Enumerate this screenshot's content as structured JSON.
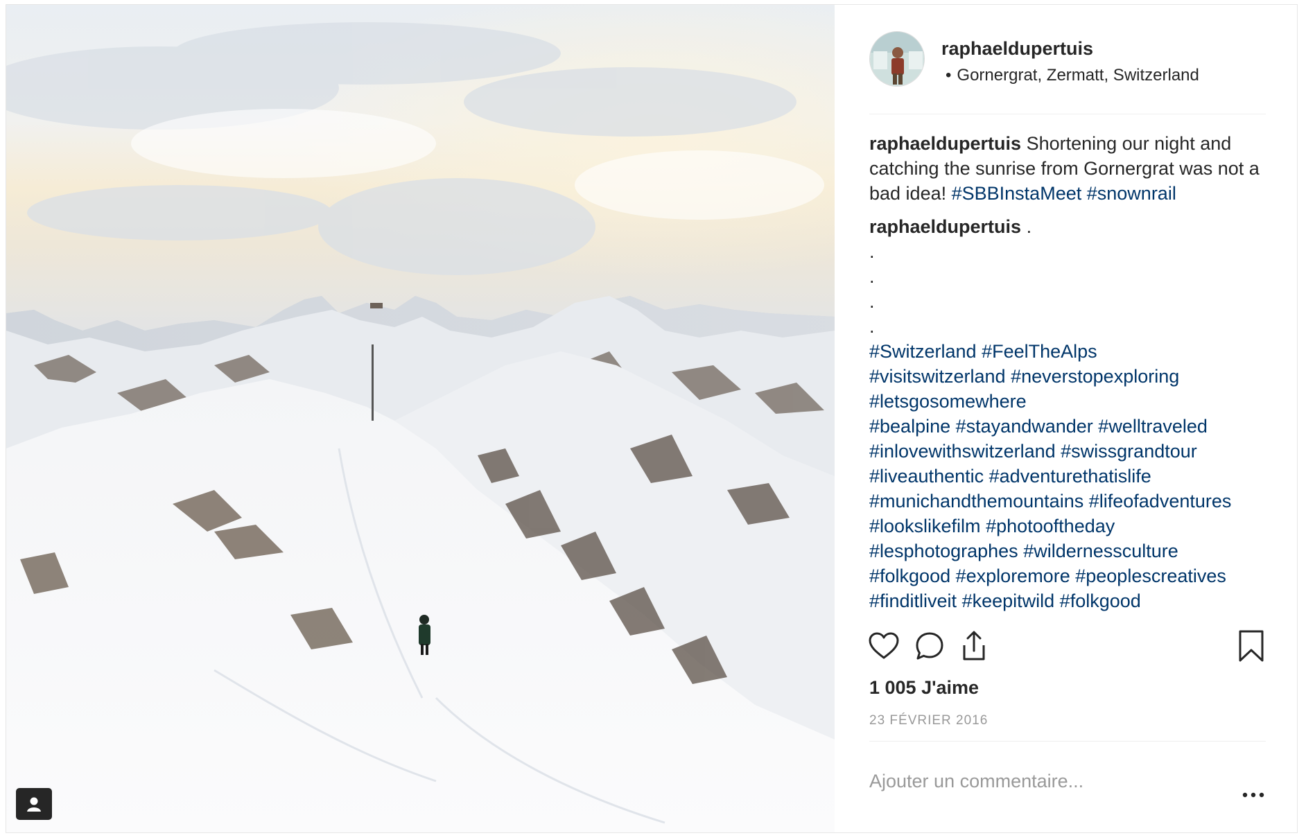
{
  "post": {
    "username": "raphaeldupertuis",
    "location": "Gornergrat, Zermatt, Switzerland",
    "location_dot": "•",
    "caption": {
      "text": "Shortening our night and catching the sunrise from Gornergrat was not a bad idea!",
      "hashtags": [
        "#SBBInstaMeet",
        "#snownrail"
      ]
    },
    "comment": {
      "username": "raphaeldupertuis",
      "first_line": ".",
      "dots": [
        ".",
        ".",
        ".",
        "."
      ],
      "hashtag_lines": [
        [
          "#Switzerland",
          "#FeelTheAlps"
        ],
        [
          "#visitswitzerland",
          "#neverstopexploring"
        ],
        [
          "#letsgosomewhere"
        ],
        [
          "#bealpine",
          "#stayandwander",
          "#welltraveled"
        ],
        [
          "#inlovewithswitzerland",
          "#swissgrandtour"
        ],
        [
          "#liveauthentic",
          "#adventurethatislife"
        ],
        [
          "#munichandthemountains",
          "#lifeofadventures"
        ],
        [
          "#lookslikefilm",
          "#photooftheday"
        ],
        [
          "#lesphotographes",
          "#wildernessculture"
        ],
        [
          "#folkgood",
          "#exploremore",
          "#peoplescreatives"
        ],
        [
          "#finditliveit",
          "#keepitwild",
          "#folkgood"
        ]
      ]
    },
    "likes": "1 005 J'aime",
    "date": "23 FÉVRIER 2016",
    "comment_placeholder": "Ajouter un commentaire...",
    "icons": {
      "like": "heart-icon",
      "comment": "comment-icon",
      "share": "share-icon",
      "save": "bookmark-icon",
      "more": "more-options-icon",
      "tagged": "user-tag-icon"
    },
    "colors": {
      "text": "#262626",
      "hashtag": "#003569",
      "muted": "#999999",
      "border": "#efefef"
    }
  }
}
